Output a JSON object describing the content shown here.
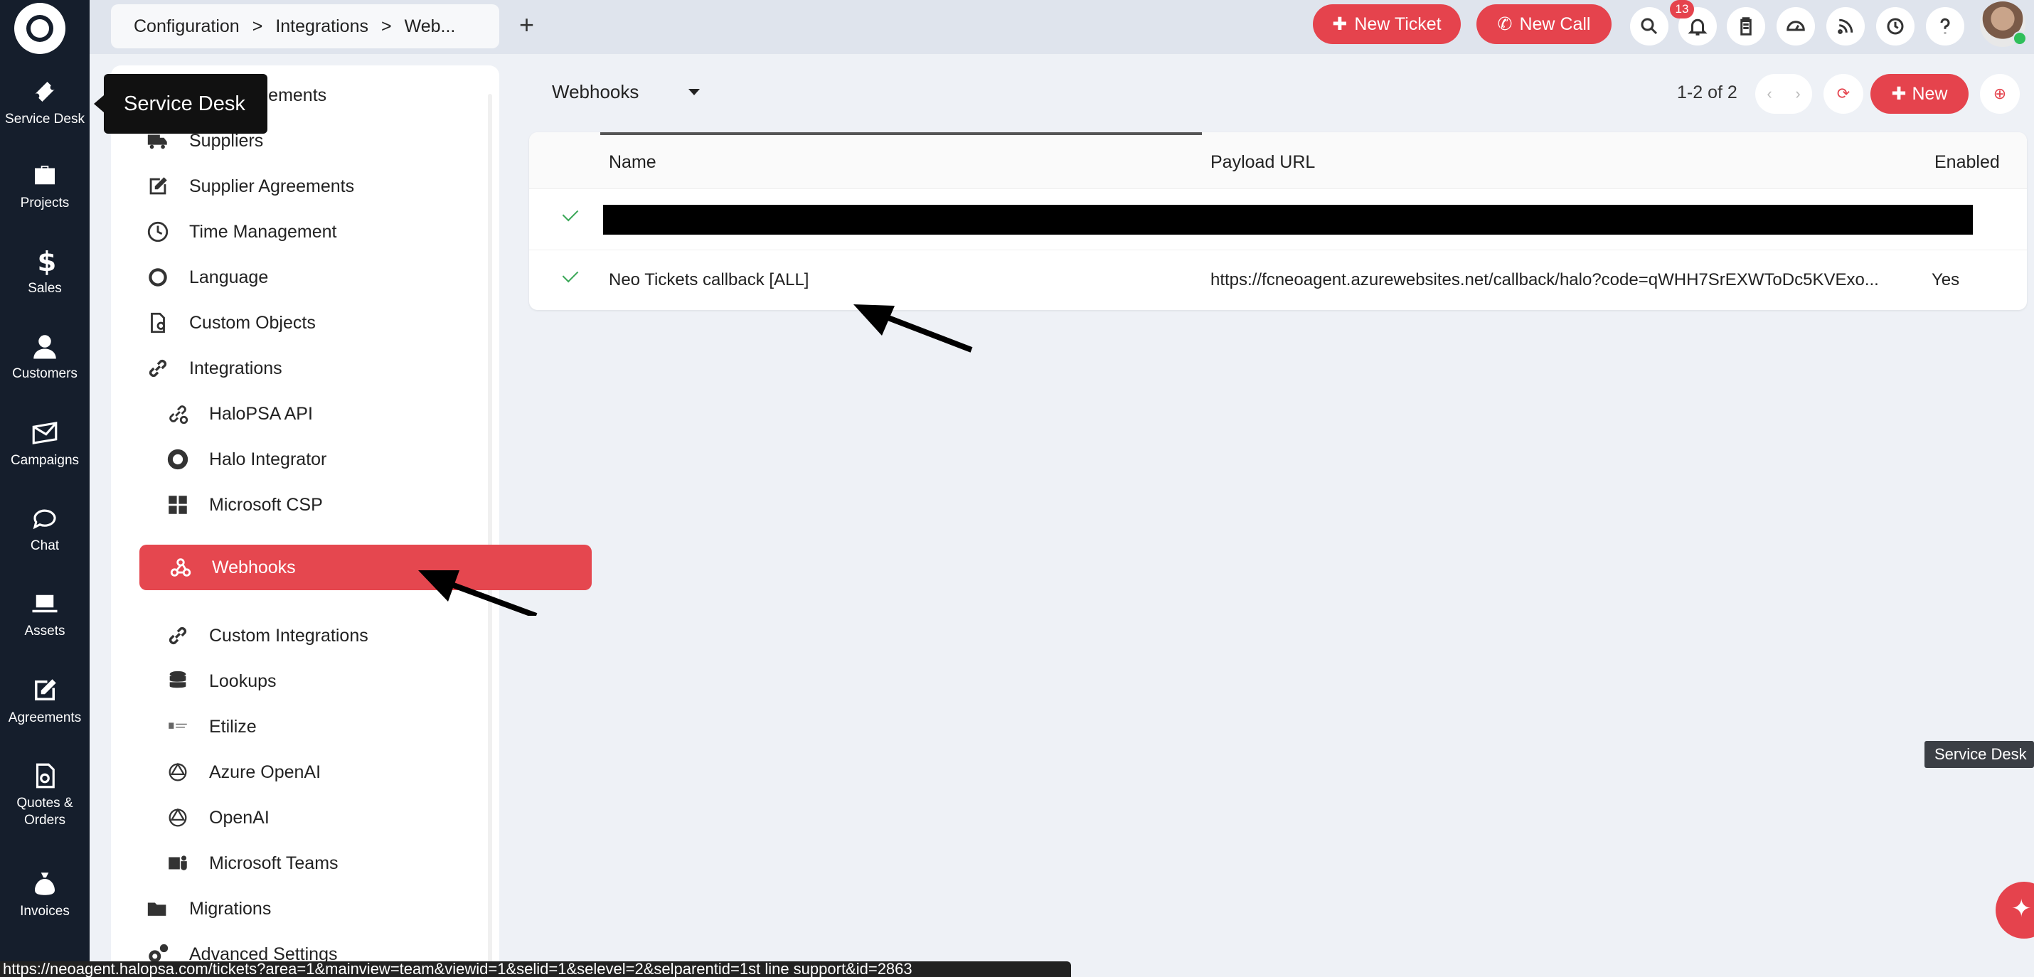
{
  "rail": {
    "items": [
      {
        "label": "Service Desk",
        "icon": "ticket-icon"
      },
      {
        "label": "Projects",
        "icon": "briefcase-icon"
      },
      {
        "label": "Sales",
        "icon": "dollar-icon"
      },
      {
        "label": "Customers",
        "icon": "person-icon"
      },
      {
        "label": "Campaigns",
        "icon": "envelope-icon"
      },
      {
        "label": "Chat",
        "icon": "chat-icon"
      },
      {
        "label": "Assets",
        "icon": "laptop-icon"
      },
      {
        "label": "Agreements",
        "icon": "pen-icon"
      },
      {
        "label": "Quotes &",
        "label2": "Orders",
        "icon": "document-icon"
      },
      {
        "label": "Invoices",
        "icon": "moneybag-icon"
      }
    ]
  },
  "tooltip": {
    "text": "Service Desk"
  },
  "topbar": {
    "breadcrumb": [
      "Configuration",
      ">",
      "Integrations",
      ">",
      "Web..."
    ],
    "add_tab": "+",
    "new_ticket": "New Ticket",
    "new_call": "New Call",
    "notification_count": "13"
  },
  "config_menu": {
    "items": [
      {
        "label": "...vel Agreements",
        "level": 1
      },
      {
        "label": "Suppliers",
        "level": 1
      },
      {
        "label": "Supplier Agreements",
        "level": 1
      },
      {
        "label": "Time Management",
        "level": 1
      },
      {
        "label": "Language",
        "level": 1
      },
      {
        "label": "Custom Objects",
        "level": 1
      },
      {
        "label": "Integrations",
        "level": 1
      },
      {
        "label": "HaloPSA API",
        "level": 2
      },
      {
        "label": "Halo Integrator",
        "level": 2
      },
      {
        "label": "Microsoft CSP",
        "level": 2
      },
      {
        "label": "Webhooks",
        "level": 2,
        "active": true
      },
      {
        "label": "Custom Integrations",
        "level": 2
      },
      {
        "label": "Lookups",
        "level": 2
      },
      {
        "label": "Etilize",
        "level": 2
      },
      {
        "label": "Azure OpenAI",
        "level": 2
      },
      {
        "label": "OpenAI",
        "level": 2
      },
      {
        "label": "Microsoft Teams",
        "level": 2
      },
      {
        "label": "Migrations",
        "level": 1
      },
      {
        "label": "Advanced Settings",
        "level": 1
      }
    ]
  },
  "main": {
    "view_label": "Webhooks",
    "pager": "1-2 of 2",
    "new_button": "New",
    "columns": {
      "name": "Name",
      "payload_url": "Payload URL",
      "enabled": "Enabled"
    },
    "rows": [
      {
        "name": "",
        "payload_url": "",
        "enabled": "",
        "redacted": true
      },
      {
        "name": "Neo Tickets callback [ALL]",
        "payload_url": "https://fcneoagent.azurewebsites.net/callback/halo?code=qWHH7SrEXWToDc5KVExo...",
        "enabled": "Yes"
      }
    ]
  },
  "status_url": "https://neoagent.halopsa.com/tickets?area=1&mainview=team&viewid=1&selid=1&selevel=2&selparentid=1st line support&id=2863",
  "side_tag": "Service Desk",
  "colors": {
    "accent": "#e5434d",
    "rail": "#151e2c",
    "topbar": "#dfe4ed"
  }
}
